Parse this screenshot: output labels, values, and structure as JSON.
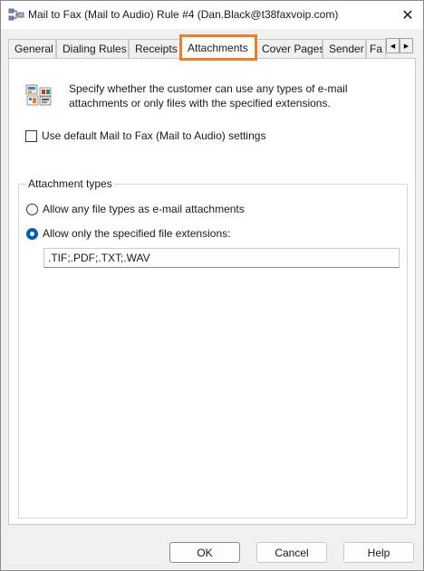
{
  "window": {
    "title": "Mail to Fax (Mail to Audio) Rule #4 (Dan.Black@t38faxvoip.com)",
    "close_glyph": "✕",
    "icon": "network-rule-icon"
  },
  "tabs": [
    {
      "label": "General",
      "active": false
    },
    {
      "label": "Dialing Rules",
      "active": false
    },
    {
      "label": "Receipts",
      "active": false
    },
    {
      "label": "Attachments",
      "active": true
    },
    {
      "label": "Cover Pages",
      "active": false
    },
    {
      "label": "Sender",
      "active": false
    },
    {
      "label": "Fa",
      "active": false
    }
  ],
  "tab_scroll": {
    "left": "◀",
    "right": "▶"
  },
  "highlight_color": "#f07f24",
  "intro": {
    "icon": "attachment-files-icon",
    "text": "Specify whether the customer can use any types of e-mail attachments or only files with the specified extensions."
  },
  "use_default": {
    "label": "Use default Mail to Fax (Mail to Audio) settings",
    "checked": false
  },
  "attachment_types": {
    "title": "Attachment types",
    "option_any": {
      "label": "Allow any file types as e-mail attachments",
      "selected": false
    },
    "option_specified": {
      "label": "Allow only the specified file extensions:",
      "selected": true
    },
    "extensions_value": ".TIF;.PDF;.TXT;.WAV"
  },
  "buttons": {
    "ok": "OK",
    "cancel": "Cancel",
    "help": "Help"
  }
}
